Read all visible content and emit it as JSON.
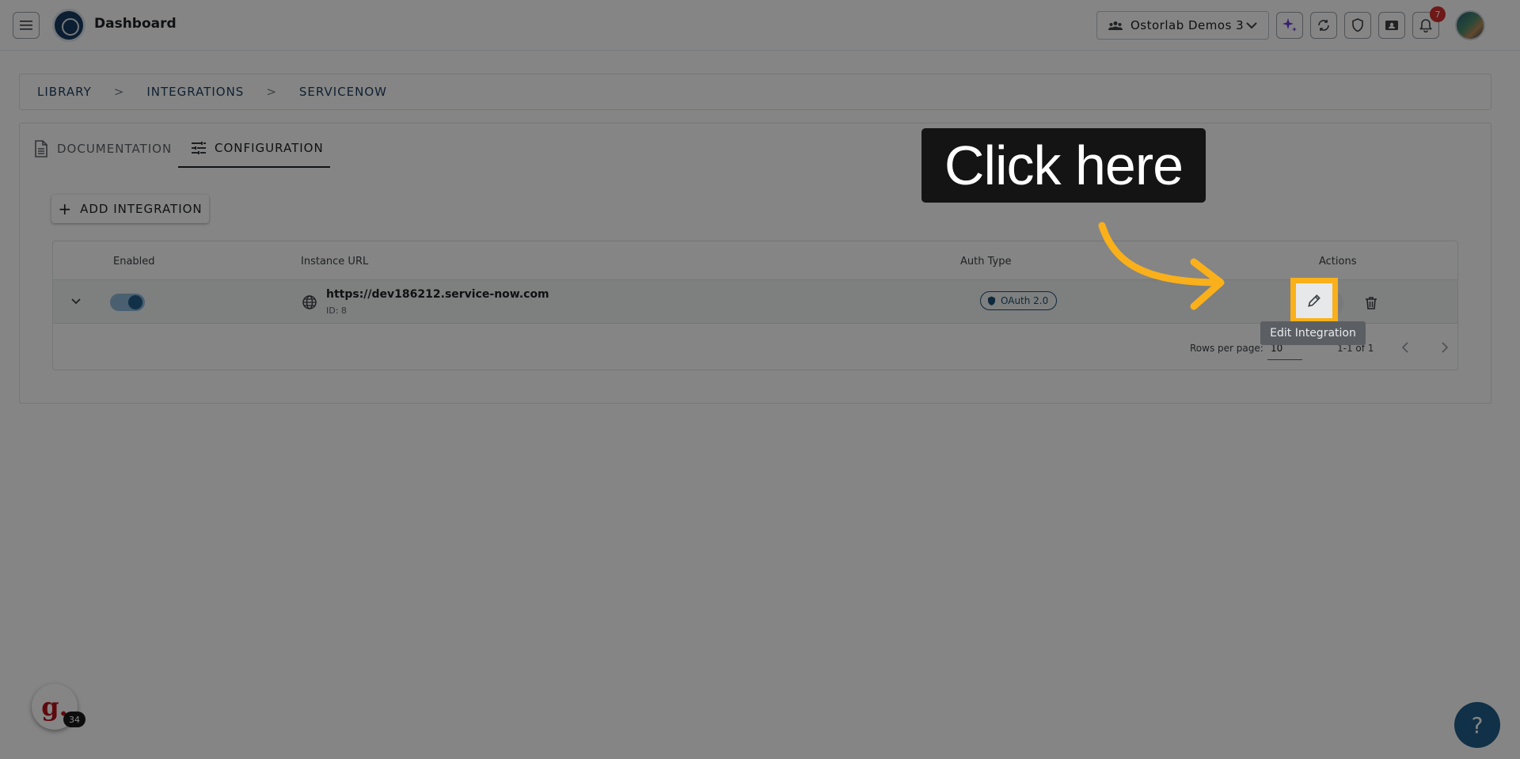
{
  "header": {
    "title": "Dashboard",
    "org_name": "Ostorlab Demos 3",
    "notification_count": "7"
  },
  "breadcrumb": {
    "items": [
      "LIBRARY",
      "INTEGRATIONS",
      "SERVICENOW"
    ],
    "separator": ">"
  },
  "tabs": [
    {
      "label": "DOCUMENTATION",
      "active": false
    },
    {
      "label": "CONFIGURATION",
      "active": true
    }
  ],
  "actions": {
    "add_integration_label": "ADD INTEGRATION"
  },
  "table": {
    "columns": [
      "Enabled",
      "Instance URL",
      "Auth Type",
      "Actions"
    ],
    "rows": [
      {
        "enabled": true,
        "instance_url": "https://dev186212.service-now.com",
        "id_label": "ID: 8",
        "auth_type": "OAuth 2.0"
      }
    ],
    "pagination": {
      "rows_per_page_label": "Rows per page:",
      "rows_per_page_value": "10",
      "range": "1-1 of 1"
    }
  },
  "overlay": {
    "callout_text": "Click here",
    "tooltip": "Edit Integration",
    "highlight_color": "#f9b01a"
  },
  "widgets": {
    "guide_logo": "g.",
    "guide_count": "34",
    "help_label": "?"
  },
  "colors": {
    "primary": "#1f5f8b",
    "badge": "#d32f2f"
  }
}
